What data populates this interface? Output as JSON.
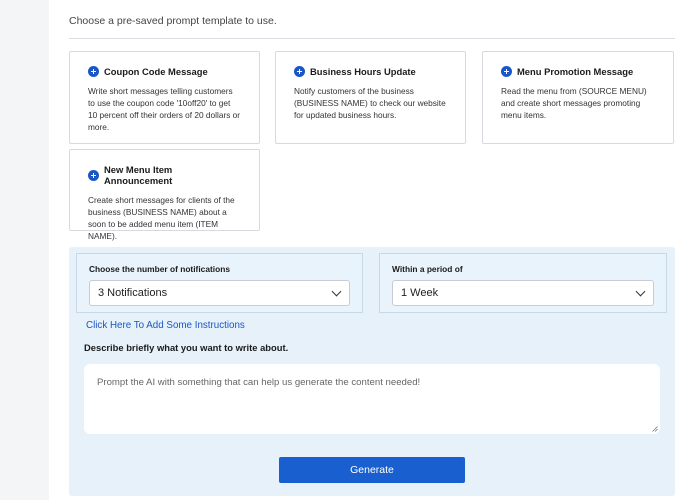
{
  "header": {
    "subtitle": "Choose a pre-saved prompt template to use."
  },
  "templates": [
    {
      "title": "Coupon Code Message",
      "description": "Write short messages telling customers to use the coupon code '10off20' to get 10 percent off their orders of 20 dollars or more.",
      "icon": "plus-circle-icon"
    },
    {
      "title": "Business Hours Update",
      "description": "Notify customers of the business (BUSINESS NAME) to check our website for updated business hours.",
      "icon": "plus-circle-icon"
    },
    {
      "title": "Menu Promotion Message",
      "description": "Read the menu from (SOURCE MENU) and create short messages promoting menu items.",
      "icon": "plus-circle-icon"
    },
    {
      "title": "New Menu Item Announcement",
      "description": "Create short messages for clients of the business (BUSINESS NAME) about a soon to be added menu item (ITEM NAME).",
      "icon": "plus-circle-icon"
    }
  ],
  "form": {
    "notifications_label": "Choose the number of notifications",
    "notifications_value": "3 Notifications",
    "period_label": "Within a period of",
    "period_value": "1 Week",
    "instructions_link": "Click Here To Add Some Instructions",
    "describe_label": "Describe briefly what you want to write about.",
    "prompt_placeholder": "Prompt the AI with something that can help us generate the content needed!",
    "prompt_value": "",
    "generate_label": "Generate"
  },
  "colors": {
    "accent": "#1a5fd0",
    "panel_bg": "#e6f1fa",
    "link": "#1a56c8"
  }
}
